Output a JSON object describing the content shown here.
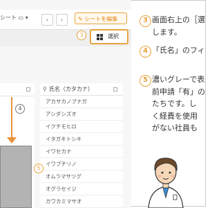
{
  "screenshot": {
    "sheet_tab": "シート",
    "toolbar_buttons": [
      "‹",
      "›"
    ],
    "edit_sheet_button": "シートを編集",
    "select_button": "選択",
    "step_markers": [
      "3",
      "4",
      "5"
    ],
    "name_column_header": "氏名（カタカナ）",
    "names": [
      "アカサカノブナガ",
      "アシダシズオ",
      "イクチモヒロ",
      "イタガキトシキ",
      "イワセカナ",
      "イワブチリノ",
      "オムラマサツグ",
      "オグラセイジ",
      "カワカミマサオ"
    ]
  },
  "steps": [
    {
      "num": "3",
      "lines": [
        "画面右上の［選",
        "します。"
      ]
    },
    {
      "num": "4",
      "lines": [
        "「氏名」のフィ"
      ]
    },
    {
      "num": "5",
      "lines": [
        "濃いグレーで表",
        "前申請「有」の",
        "たちです。し",
        "く経費を使用",
        "がない社員も"
      ]
    }
  ],
  "colors": {
    "accent": "#e8a33d",
    "arrow": "#e8913a",
    "gray_block": "#b3b3b3"
  }
}
